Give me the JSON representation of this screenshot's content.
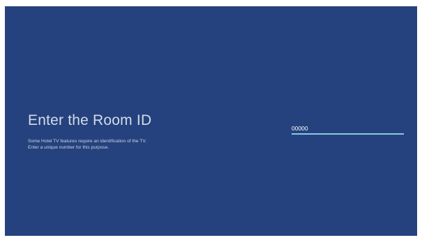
{
  "room_id_screen": {
    "title": "Enter the Room ID",
    "description_line1": "Some Hotel TV features require an identification of the TV.",
    "description_line2": "Enter a unique number for this purpose.",
    "room_id_value": "00000"
  },
  "colors": {
    "background": "#25427e",
    "text": "#d3dbe8",
    "field_underline": "#8ec8e3"
  }
}
